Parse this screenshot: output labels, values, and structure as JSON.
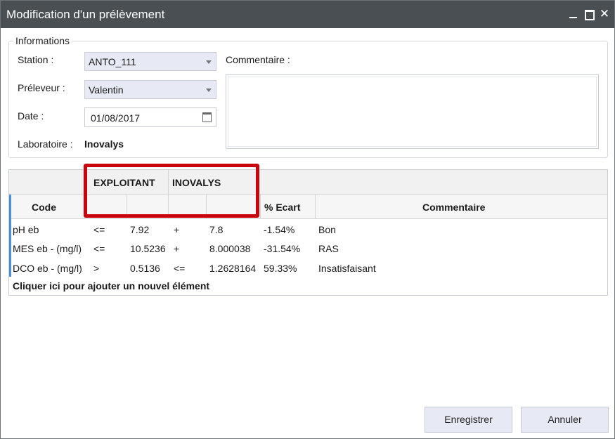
{
  "window": {
    "title": "Modification d'un prélèvement"
  },
  "informations": {
    "legend": "Informations",
    "station_label": "Station :",
    "station_value": "ANTO_111",
    "preleveur_label": "Préleveur :",
    "preleveur_value": "Valentin",
    "date_label": "Date :",
    "date_value": "01/08/2017",
    "laboratoire_label": "Laboratoire :",
    "laboratoire_value": "Inovalys",
    "commentaire_label": "Commentaire :",
    "commentaire_value": ""
  },
  "grid": {
    "band_exploitant": "EXPLOITANT",
    "band_inovalys": "INOVALYS",
    "headers": {
      "code": "Code",
      "ecart": "% Ecart",
      "commentaire": "Commentaire"
    },
    "rows": [
      {
        "code": "pH eb",
        "op1": "<=",
        "v1": "7.92",
        "op2": "+",
        "v2": "7.8",
        "ecart": "-1.54%",
        "commentaire": "Bon"
      },
      {
        "code": "MES eb - (mg/l)",
        "op1": "<=",
        "v1": "10.5236",
        "op2": "+",
        "v2": "8.000038",
        "ecart": "-31.54%",
        "commentaire": "RAS"
      },
      {
        "code": "DCO eb - (mg/l)",
        "op1": ">",
        "v1": "0.5136",
        "op2": "<=",
        "v2": "1.2628164",
        "ecart": "59.33%",
        "commentaire": "Insatisfaisant"
      }
    ],
    "add_label": "Cliquer ici pour ajouter un nouvel élément"
  },
  "buttons": {
    "save": "Enregistrer",
    "cancel": "Annuler"
  },
  "icons": {
    "minimize": "minimize-icon",
    "maximize": "maximize-icon",
    "close": "close-icon",
    "dropdown": "chevron-down-icon",
    "calendar": "calendar-icon",
    "close_glyph": "✕"
  },
  "colors": {
    "titlebar": "#4a4f53",
    "highlight": "#c8050c",
    "button": "#e7e9f4",
    "row_indicator": "#4a90d9"
  }
}
